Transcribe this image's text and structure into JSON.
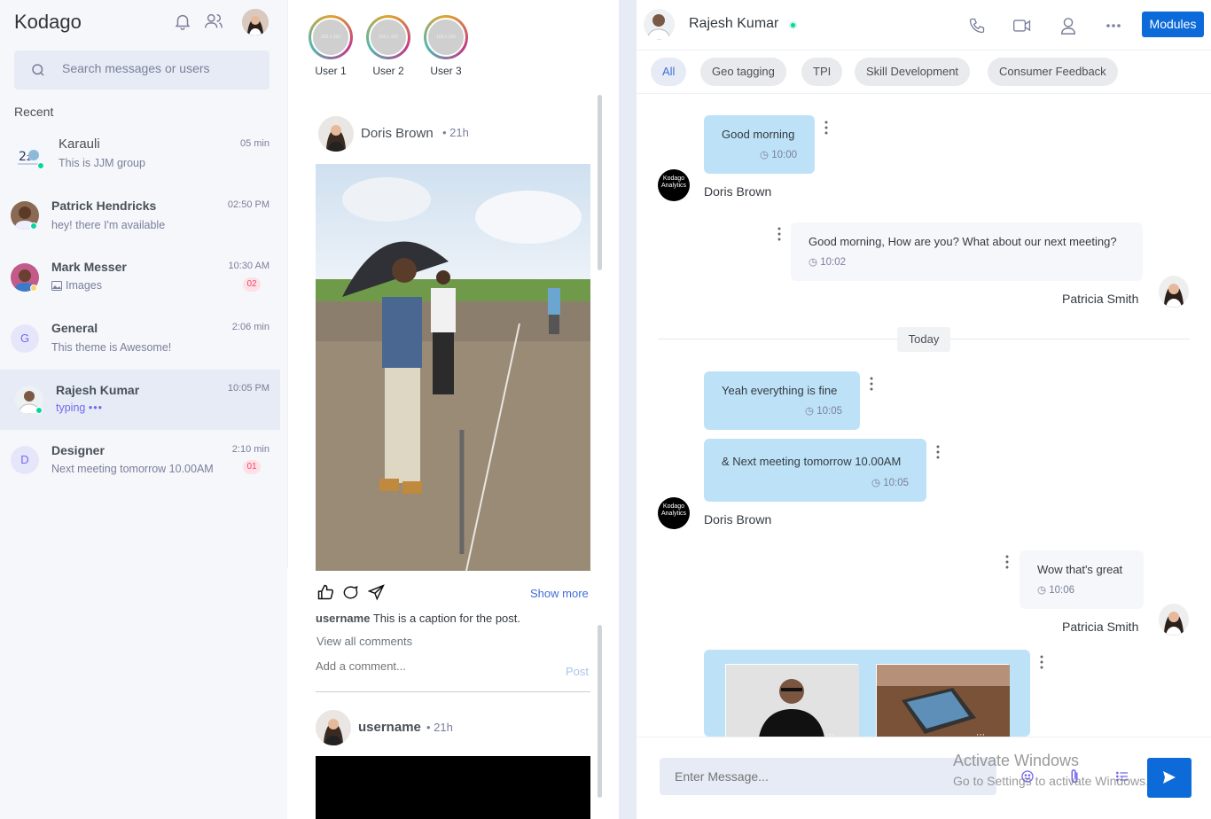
{
  "sidebar": {
    "brand": "Kodago",
    "search_placeholder": "Search messages or users",
    "recent_label": "Recent",
    "chats": [
      {
        "name": "Karauli",
        "message": "This is JJM group",
        "time": "05 min"
      },
      {
        "name": "Patrick Hendricks",
        "message": "hey! there I'm available",
        "time": "02:50 PM"
      },
      {
        "name": "Mark Messer",
        "message": "Images",
        "time": "10:30 AM",
        "badge": "02"
      },
      {
        "name": "General",
        "message": "This theme is Awesome!",
        "time": "2:06 min",
        "initial": "G"
      },
      {
        "name": "Rajesh Kumar",
        "message": "typing",
        "time": "10:05 PM"
      },
      {
        "name": "Designer",
        "message": "Next meeting tomorrow 10.00AM",
        "time": "2:10 min",
        "initial": "D",
        "badge": "01"
      }
    ]
  },
  "feed": {
    "stories": [
      "User 1",
      "User 2",
      "User 3"
    ],
    "story_placeholder": "150 x 150",
    "post1": {
      "author": "Doris Brown",
      "age": "21h",
      "show_more": "Show more",
      "caption_user": "username",
      "caption": "This is a caption for the post.",
      "view_comments": "View all comments",
      "comment_placeholder": "Add a comment...",
      "post_label": "Post"
    },
    "post2": {
      "author": "username",
      "age": "21h"
    }
  },
  "chat": {
    "contact": "Rajesh Kumar",
    "modules_label": "Modules",
    "tabs": [
      "All",
      "Geo tagging",
      "TPI",
      "Skill Development",
      "Consumer Feedback"
    ],
    "messages": [
      {
        "text": "Good morning",
        "time": "10:00"
      },
      {
        "sender": "Doris Brown"
      },
      {
        "text": "Good morning, How are you? What about our next meeting?",
        "time": "10:02"
      },
      {
        "sender": "Patricia Smith"
      },
      {
        "divider": "Today"
      },
      {
        "text": "Yeah everything is fine",
        "time": "10:05"
      },
      {
        "text": "& Next meeting tomorrow 10.00AM",
        "time": "10:05"
      },
      {
        "sender": "Doris Brown"
      },
      {
        "text": "Wow that's great",
        "time": "10:06"
      },
      {
        "sender": "Patricia Smith"
      }
    ],
    "logo_text": "Kodago Analytics",
    "input_placeholder": "Enter Message...",
    "watermark1": "Activate Windows",
    "watermark2": "Go to Settings to activate Windows."
  }
}
